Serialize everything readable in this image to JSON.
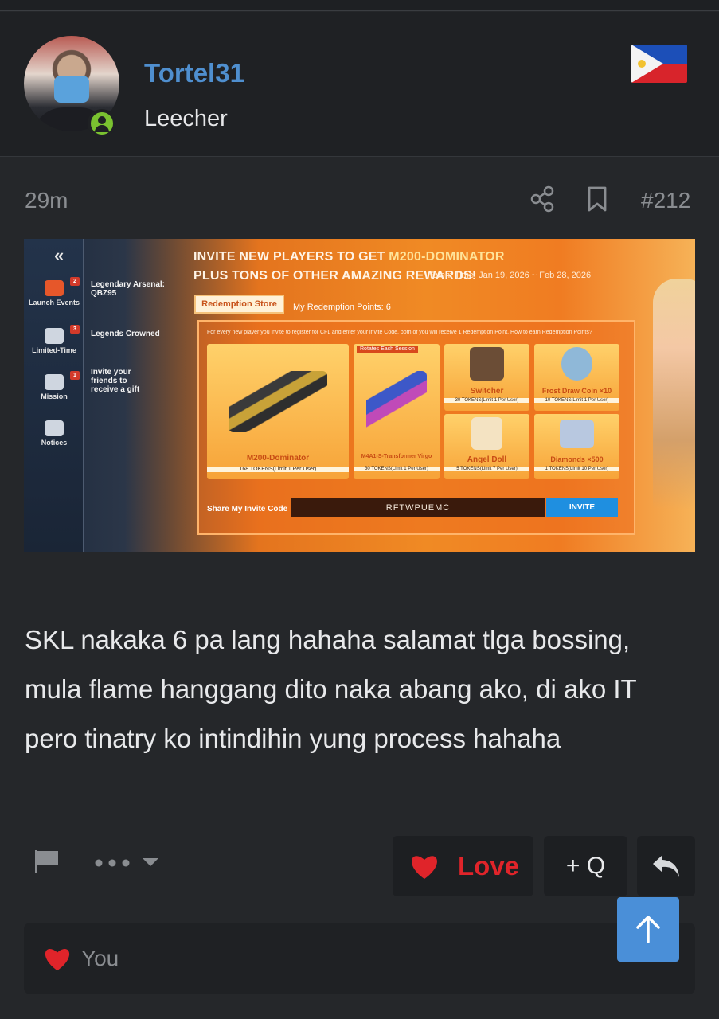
{
  "user": {
    "username": "Tortel31",
    "title": "Leecher",
    "status": "online",
    "country_flag": "Philippines"
  },
  "post": {
    "time": "29m",
    "number": "#212",
    "body": "SKL nakaka 6 pa lang hahaha salamat tlga bossing, mula flame hanggang dito naka abang ako, di ako IT pero tinatry ko intindihin yung process hahaha"
  },
  "attachment": {
    "nav": [
      {
        "label": "Launch Events",
        "badge": "2"
      },
      {
        "label": "Limited-Time",
        "badge": "3"
      },
      {
        "label": "Mission",
        "badge": "1"
      },
      {
        "label": "Notices",
        "badge": ""
      }
    ],
    "side_items": [
      "Legendary Arsenal: QBZ95",
      "Legends Crowned",
      "Invite your friends to receive a gift"
    ],
    "headline_1_prefix": "INVITE NEW PLAYERS TO GET ",
    "headline_1_highlight": "M200-DOMINATOR",
    "headline_2": "PLUS TONS OF OTHER AMAZING REWARDS!",
    "event_time": "Event Time: Jan 19, 2026 ~ Feb 28, 2026",
    "tab_label": "Redemption Store",
    "points_label": "My Redemption Points: 6",
    "note": "For every new player you invite to register for CFL and enter your invite Code, both of you will receive 1 Redemption Point.    How to earn Redemption Points?",
    "rotates_label": "Rotates Each Session",
    "rewards": [
      {
        "name": "M200-Dominator",
        "tokens": "168 TOKENS(Limit 1 Per User)"
      },
      {
        "name": "M4A1-S-Transformer Virgo",
        "tokens": "30 TOKENS(Limit 1 Per User)"
      },
      {
        "name": "Switcher",
        "tokens": "30 TOKENS(Limit 1 Per User)"
      },
      {
        "name": "Frost Draw Coin ×10",
        "tokens": "10 TOKENS(Limit 1 Per User)"
      },
      {
        "name": "Angel Doll",
        "tokens": "5 TOKENS(Limit 7 Per User)"
      },
      {
        "name": "Diamonds ×500",
        "tokens": "1 TOKENS(Limit 10 Per User)"
      }
    ],
    "share_label": "Share My Invite Code",
    "invite_code": "RFTWPUEMC",
    "invite_button": "INVITE"
  },
  "actions": {
    "love_label": "Love",
    "quote_label": "+ Q"
  },
  "reactions": {
    "who": "You"
  },
  "colors": {
    "background": "#25272a",
    "username": "#4f8fcf",
    "love": "#e0242a",
    "online": "#7ac230",
    "scroll_top": "#4a8fd8"
  },
  "icons": [
    "share-icon",
    "bookmark-icon",
    "flag-icon",
    "more-dots-icon",
    "heart-icon",
    "reply-icon",
    "arrow-up-icon"
  ]
}
